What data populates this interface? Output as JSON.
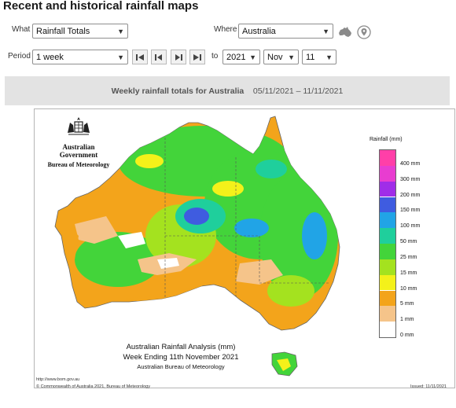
{
  "page_title": "Recent and historical rainfall maps",
  "controls": {
    "what_label": "What",
    "what_value": "Rainfall Totals",
    "where_label": "Where",
    "where_value": "Australia",
    "period_label": "Period",
    "period_value": "1 week",
    "to_label": "to",
    "year_value": "2021",
    "month_value": "Nov",
    "day_value": "11",
    "icons": [
      "australia-map-icon",
      "location-pin-icon",
      "skip-back-icon",
      "step-back-icon",
      "step-forward-icon",
      "skip-forward-icon",
      "chevron-down-icon"
    ]
  },
  "banner": {
    "title": "Weekly rainfall totals for Australia",
    "date_range": "05/11/2021 – 11/11/2021"
  },
  "map": {
    "govt_line1": "Australian Government",
    "govt_line2": "Bureau of Meteorology",
    "caption_line1": "Australian Rainfall Analysis (mm)",
    "caption_line2": "Week Ending 11th November 2021",
    "caption_line3": "Australian Bureau of Meteorology",
    "url": "http://www.bom.gov.au",
    "copyright": "© Commonwealth of Australia 2021, Bureau of Meteorology",
    "issued": "Issued: 11/11/2021",
    "legend": {
      "title": "Rainfall (mm)",
      "bands": [
        {
          "label": "400 mm",
          "color": "#ff3fa8"
        },
        {
          "label": "300 mm",
          "color": "#e83dd0"
        },
        {
          "label": "200 mm",
          "color": "#a02de8"
        },
        {
          "label": "150 mm",
          "color": "#3f5ce0"
        },
        {
          "label": "100 mm",
          "color": "#21a4e6"
        },
        {
          "label": "50 mm",
          "color": "#1fcf9c"
        },
        {
          "label": "25 mm",
          "color": "#43d43a"
        },
        {
          "label": "15 mm",
          "color": "#a4e21f"
        },
        {
          "label": "10 mm",
          "color": "#f4f11a"
        },
        {
          "label": "5 mm",
          "color": "#f3a41b"
        },
        {
          "label": "1 mm",
          "color": "#f5c48a"
        },
        {
          "label": "0 mm",
          "color": "#ffffff"
        }
      ]
    }
  }
}
